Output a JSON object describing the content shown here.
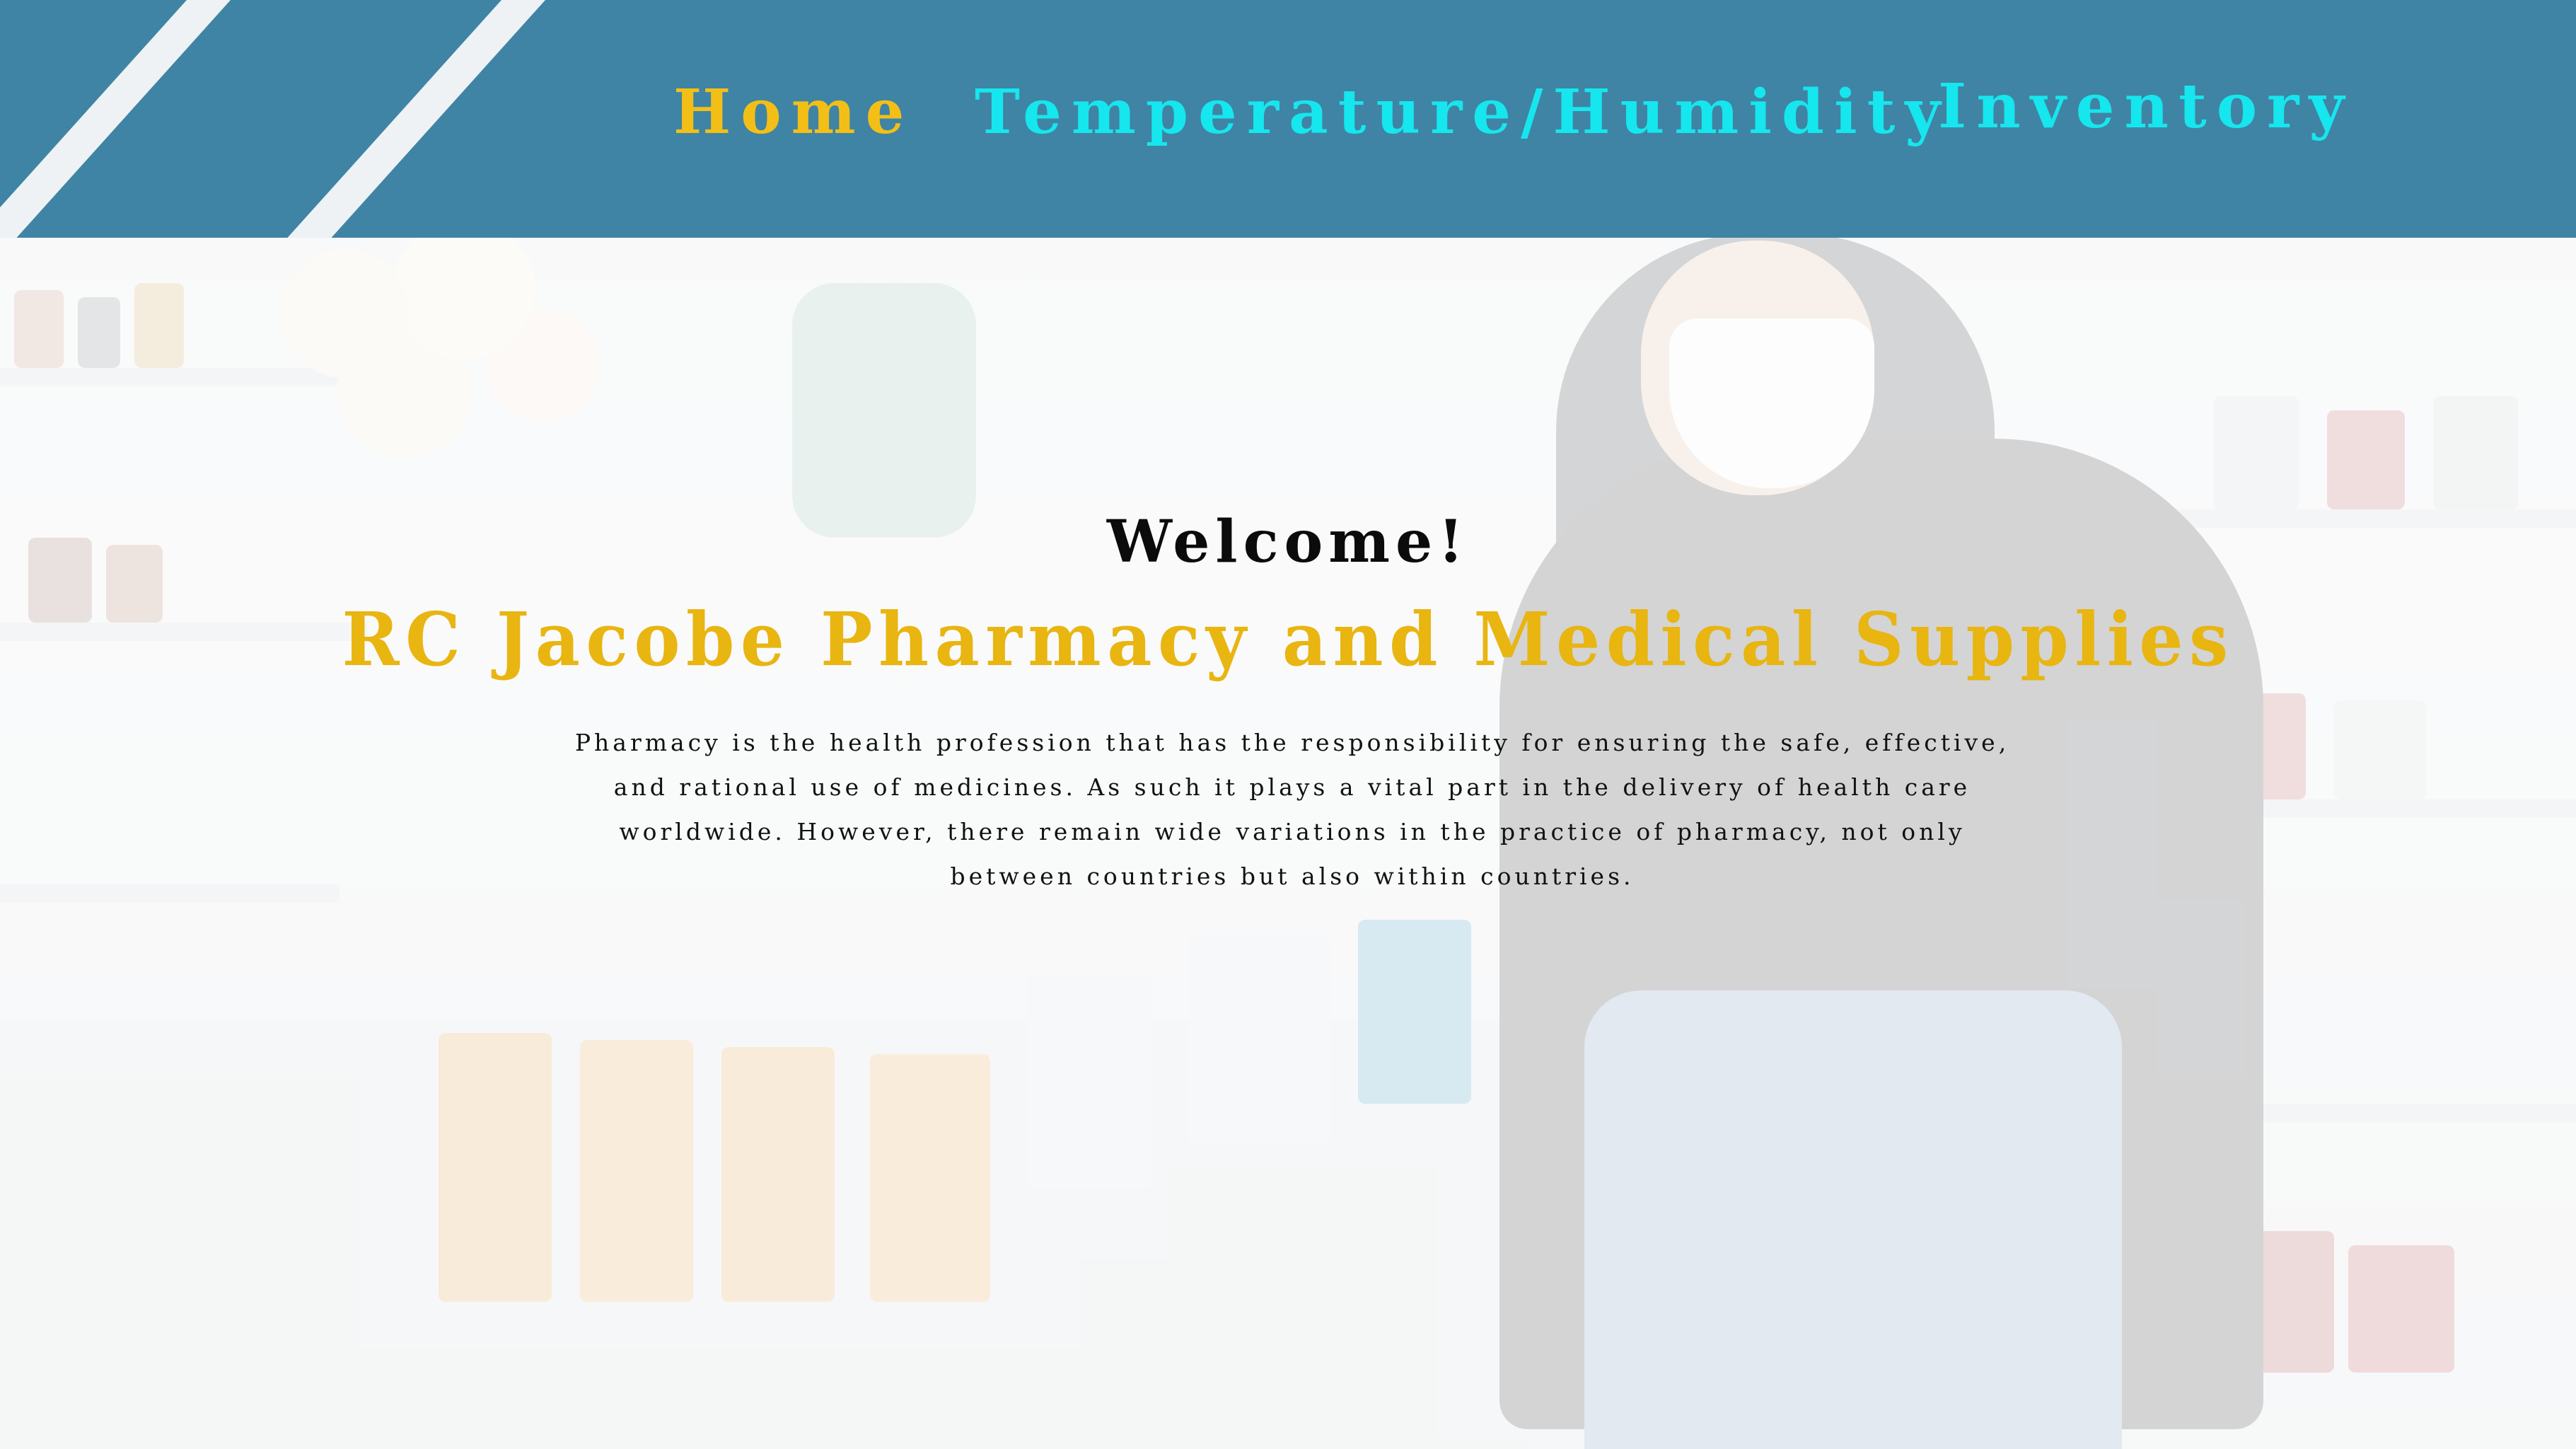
{
  "colors": {
    "topbar": "#3f84a4",
    "nav_active": "#f3bf17",
    "nav_link": "#16e6ee",
    "brand_gold": "#e8b511",
    "text_dark": "#0b0b0b"
  },
  "nav": {
    "items": [
      {
        "label": "Home",
        "active": true
      },
      {
        "label": "Temperature/Humidity",
        "active": false
      },
      {
        "label": "Inventory",
        "active": false
      }
    ]
  },
  "hero": {
    "welcome": "Welcome!",
    "title": "RC Jacobe Pharmacy and Medical Supplies",
    "body": "Pharmacy is the health profession that has the responsibility for ensuring the safe, effective, and rational use of medicines. As such it plays a vital part in the delivery of health care worldwide. However, there remain wide variations in the practice of pharmacy, not only between countries but also within countries."
  }
}
